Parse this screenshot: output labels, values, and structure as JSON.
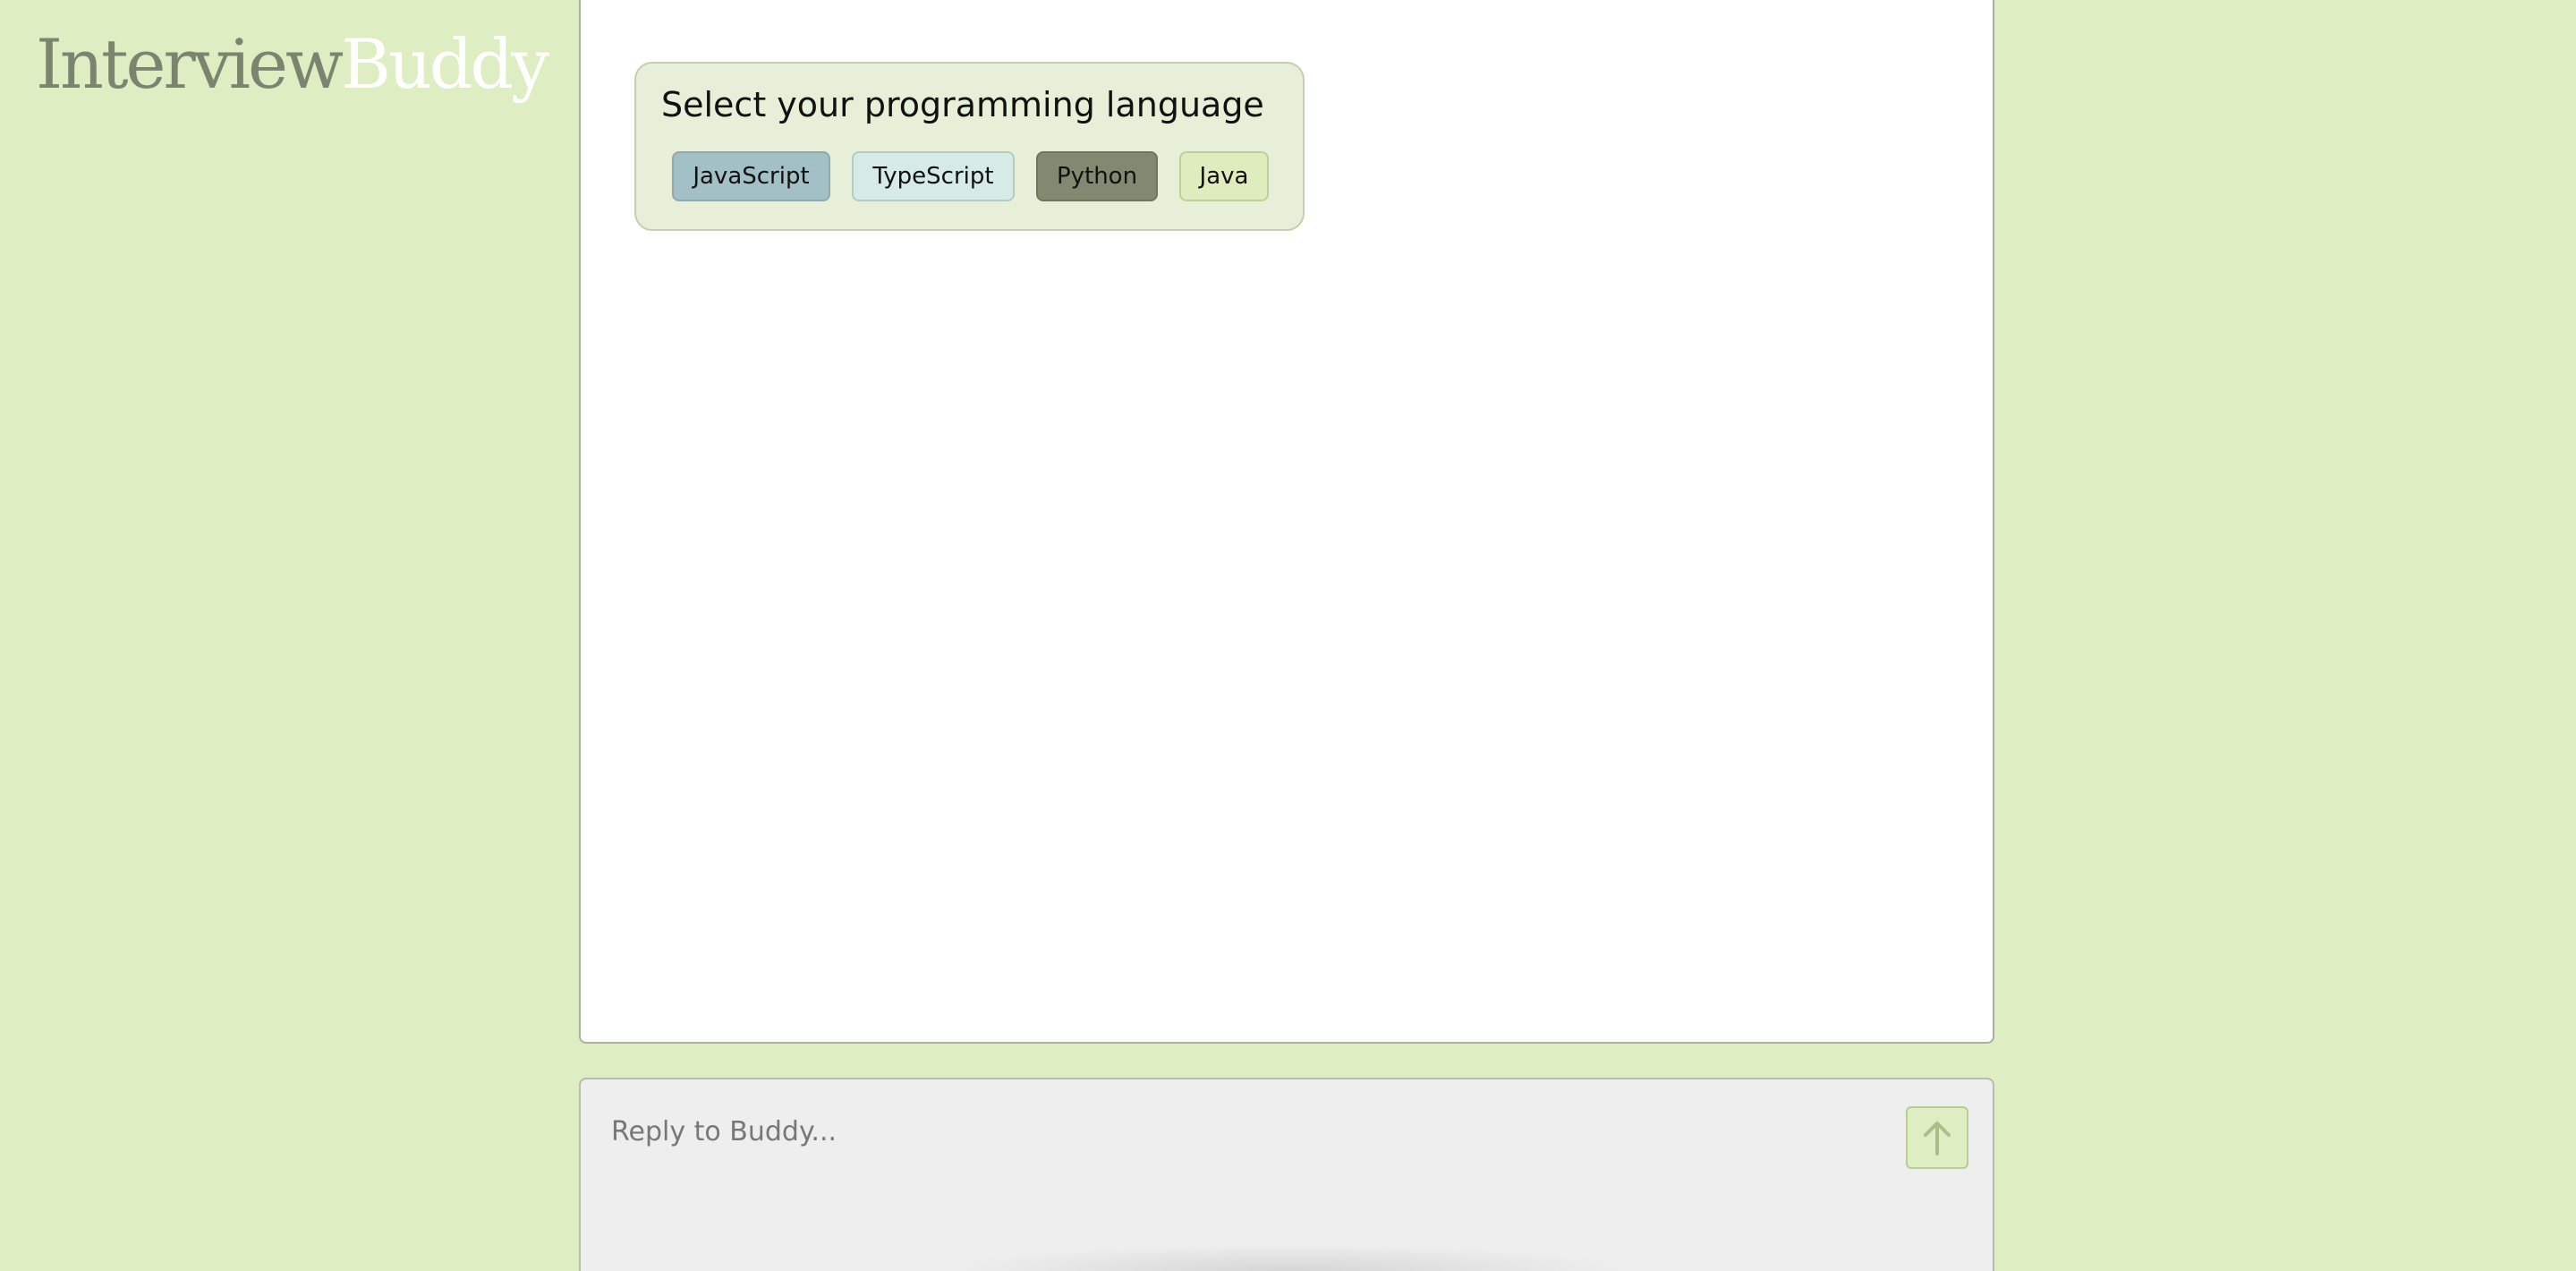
{
  "logo": {
    "part1": "Interview",
    "part2": "Buddy"
  },
  "language_prompt": {
    "title": "Select your programming language",
    "options": [
      "JavaScript",
      "TypeScript",
      "Python",
      "Java"
    ]
  },
  "reply": {
    "placeholder": "Reply to Buddy...",
    "value": ""
  },
  "icons": {
    "send": "arrow-up-icon"
  },
  "colors": {
    "background": "#dfedc3",
    "javascript": "#a3c0c6",
    "typescript": "#d7ebe6",
    "python": "#838871",
    "java": "#dfedbe"
  }
}
